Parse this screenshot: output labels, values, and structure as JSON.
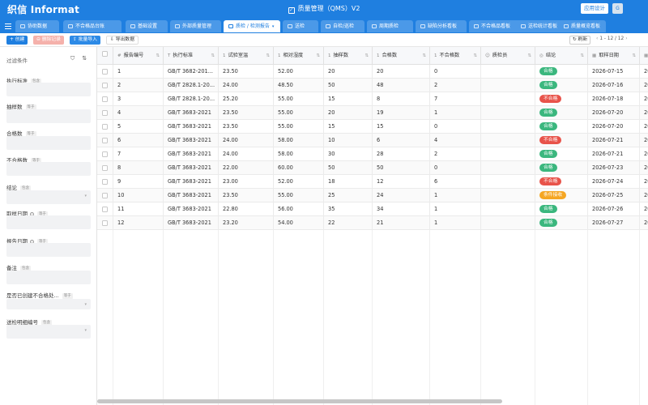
{
  "header": {
    "logo_text": "织信 Informat",
    "title": "质量管理（QMS）V2",
    "design_button": "应用设计",
    "avatar_text": "G"
  },
  "nav": {
    "tabs": [
      {
        "label": "协助数据",
        "active": false
      },
      {
        "label": "不合格品台账",
        "active": false
      },
      {
        "label": "基础设置",
        "active": false
      },
      {
        "label": "外部质量管理",
        "active": false
      },
      {
        "label": "质检 / 检测报告",
        "active": true
      },
      {
        "label": "送检",
        "active": false
      },
      {
        "label": "自检/巡检",
        "active": false
      },
      {
        "label": "周期质检",
        "active": false
      },
      {
        "label": "缺陷分析看板",
        "active": false
      },
      {
        "label": "不合格品看板",
        "active": false
      },
      {
        "label": "送检统计看板",
        "active": false
      },
      {
        "label": "质量概览看板",
        "active": false
      }
    ]
  },
  "toolbar": {
    "create": "+ 创建",
    "delete": "删除记录",
    "import": "批量导入",
    "export": "导出数据",
    "refresh": "刷新",
    "pagination": "1 - 12 / 12"
  },
  "filters": {
    "title": "过滤条件",
    "items": [
      {
        "label": "执行标准",
        "tag": "包含",
        "info": false,
        "select": false
      },
      {
        "label": "抽样数",
        "tag": "等于",
        "info": false,
        "select": false
      },
      {
        "label": "合格数",
        "tag": "等于",
        "info": false,
        "select": false
      },
      {
        "label": "不合格数",
        "tag": "等于",
        "info": false,
        "select": false
      },
      {
        "label": "结论",
        "tag": "包含",
        "info": false,
        "select": true
      },
      {
        "label": "取样日期",
        "tag": "等于",
        "info": true,
        "select": false
      },
      {
        "label": "报告日期",
        "tag": "等于",
        "info": true,
        "select": false
      },
      {
        "label": "备注",
        "tag": "包含",
        "info": false,
        "select": false
      },
      {
        "label": "是否已创建不合格处...",
        "tag": "等于",
        "info": false,
        "select": true
      },
      {
        "label": "送检明细编号",
        "tag": "包含",
        "info": false,
        "select": true
      }
    ]
  },
  "table": {
    "columns": [
      {
        "label": "报告编号",
        "icon": "#"
      },
      {
        "label": "执行标准",
        "icon": "T"
      },
      {
        "label": "试验室温",
        "icon": "1"
      },
      {
        "label": "相对湿度",
        "icon": "1"
      },
      {
        "label": "抽样数",
        "icon": "1"
      },
      {
        "label": "合格数",
        "icon": "1"
      },
      {
        "label": "不合格数",
        "icon": "1"
      },
      {
        "label": "质检员",
        "icon": "☺"
      },
      {
        "label": "结论",
        "icon": "◎"
      },
      {
        "label": "取样日期",
        "icon": "▦"
      },
      {
        "label": "报",
        "icon": "▦"
      }
    ],
    "rows": [
      {
        "id": "1",
        "std": "GB/T 3682-201...",
        "temp": "23.50",
        "hum": "52.00",
        "sample": "20",
        "pass": "20",
        "fail": "0",
        "inspector": "",
        "result": "合格",
        "date": "2026-07-15",
        "rep": "20"
      },
      {
        "id": "2",
        "std": "GB/T 2828.1-20...",
        "temp": "24.00",
        "hum": "48.50",
        "sample": "50",
        "pass": "48",
        "fail": "2",
        "inspector": "",
        "result": "合格",
        "date": "2026-07-16",
        "rep": "20"
      },
      {
        "id": "3",
        "std": "GB/T 2828.1-20...",
        "temp": "25.20",
        "hum": "55.00",
        "sample": "15",
        "pass": "8",
        "fail": "7",
        "inspector": "",
        "result": "不合格",
        "date": "2026-07-18",
        "rep": "20"
      },
      {
        "id": "4",
        "std": "GB/T 3683-2021",
        "temp": "23.50",
        "hum": "55.00",
        "sample": "20",
        "pass": "19",
        "fail": "1",
        "inspector": "",
        "result": "合格",
        "date": "2026-07-20",
        "rep": "20"
      },
      {
        "id": "5",
        "std": "GB/T 3683-2021",
        "temp": "23.50",
        "hum": "55.00",
        "sample": "15",
        "pass": "15",
        "fail": "0",
        "inspector": "",
        "result": "合格",
        "date": "2026-07-20",
        "rep": "20"
      },
      {
        "id": "6",
        "std": "GB/T 3683-2021",
        "temp": "24.00",
        "hum": "58.00",
        "sample": "10",
        "pass": "6",
        "fail": "4",
        "inspector": "",
        "result": "不合格",
        "date": "2026-07-21",
        "rep": "20"
      },
      {
        "id": "7",
        "std": "GB/T 3683-2021",
        "temp": "24.00",
        "hum": "58.00",
        "sample": "30",
        "pass": "28",
        "fail": "2",
        "inspector": "",
        "result": "合格",
        "date": "2026-07-21",
        "rep": "20"
      },
      {
        "id": "8",
        "std": "GB/T 3683-2021",
        "temp": "22.00",
        "hum": "60.00",
        "sample": "50",
        "pass": "50",
        "fail": "0",
        "inspector": "",
        "result": "合格",
        "date": "2026-07-23",
        "rep": "20"
      },
      {
        "id": "9",
        "std": "GB/T 3683-2021",
        "temp": "23.00",
        "hum": "52.00",
        "sample": "18",
        "pass": "12",
        "fail": "6",
        "inspector": "",
        "result": "不合格",
        "date": "2026-07-24",
        "rep": "20"
      },
      {
        "id": "10",
        "std": "GB/T 3683-2021",
        "temp": "23.50",
        "hum": "55.00",
        "sample": "25",
        "pass": "24",
        "fail": "1",
        "inspector": "",
        "result": "条件接收",
        "date": "2026-07-25",
        "rep": "20"
      },
      {
        "id": "11",
        "std": "GB/T 3683-2021",
        "temp": "22.80",
        "hum": "56.00",
        "sample": "35",
        "pass": "34",
        "fail": "1",
        "inspector": "",
        "result": "合格",
        "date": "2026-07-26",
        "rep": "20"
      },
      {
        "id": "12",
        "std": "GB/T 3683-2021",
        "temp": "23.20",
        "hum": "54.00",
        "sample": "22",
        "pass": "21",
        "fail": "1",
        "inspector": "",
        "result": "合格",
        "date": "2026-07-27",
        "rep": "20"
      }
    ]
  },
  "result_colors": {
    "合格": "#3bb77e",
    "不合格": "#e8534a",
    "条件接收": "#f5a623"
  }
}
